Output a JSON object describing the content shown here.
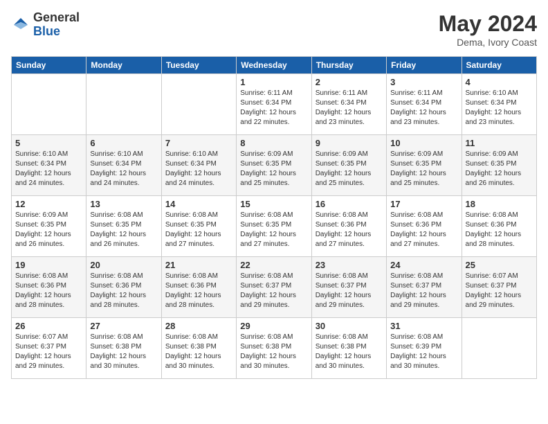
{
  "logo": {
    "general": "General",
    "blue": "Blue"
  },
  "calendar": {
    "title": "May 2024",
    "subtitle": "Dema, Ivory Coast"
  },
  "weekdays": [
    "Sunday",
    "Monday",
    "Tuesday",
    "Wednesday",
    "Thursday",
    "Friday",
    "Saturday"
  ],
  "weeks": [
    [
      {
        "day": "",
        "sunrise": "",
        "sunset": "",
        "daylight": ""
      },
      {
        "day": "",
        "sunrise": "",
        "sunset": "",
        "daylight": ""
      },
      {
        "day": "",
        "sunrise": "",
        "sunset": "",
        "daylight": ""
      },
      {
        "day": "1",
        "sunrise": "Sunrise: 6:11 AM",
        "sunset": "Sunset: 6:34 PM",
        "daylight": "Daylight: 12 hours and 22 minutes."
      },
      {
        "day": "2",
        "sunrise": "Sunrise: 6:11 AM",
        "sunset": "Sunset: 6:34 PM",
        "daylight": "Daylight: 12 hours and 23 minutes."
      },
      {
        "day": "3",
        "sunrise": "Sunrise: 6:11 AM",
        "sunset": "Sunset: 6:34 PM",
        "daylight": "Daylight: 12 hours and 23 minutes."
      },
      {
        "day": "4",
        "sunrise": "Sunrise: 6:10 AM",
        "sunset": "Sunset: 6:34 PM",
        "daylight": "Daylight: 12 hours and 23 minutes."
      }
    ],
    [
      {
        "day": "5",
        "sunrise": "Sunrise: 6:10 AM",
        "sunset": "Sunset: 6:34 PM",
        "daylight": "Daylight: 12 hours and 24 minutes."
      },
      {
        "day": "6",
        "sunrise": "Sunrise: 6:10 AM",
        "sunset": "Sunset: 6:34 PM",
        "daylight": "Daylight: 12 hours and 24 minutes."
      },
      {
        "day": "7",
        "sunrise": "Sunrise: 6:10 AM",
        "sunset": "Sunset: 6:34 PM",
        "daylight": "Daylight: 12 hours and 24 minutes."
      },
      {
        "day": "8",
        "sunrise": "Sunrise: 6:09 AM",
        "sunset": "Sunset: 6:35 PM",
        "daylight": "Daylight: 12 hours and 25 minutes."
      },
      {
        "day": "9",
        "sunrise": "Sunrise: 6:09 AM",
        "sunset": "Sunset: 6:35 PM",
        "daylight": "Daylight: 12 hours and 25 minutes."
      },
      {
        "day": "10",
        "sunrise": "Sunrise: 6:09 AM",
        "sunset": "Sunset: 6:35 PM",
        "daylight": "Daylight: 12 hours and 25 minutes."
      },
      {
        "day": "11",
        "sunrise": "Sunrise: 6:09 AM",
        "sunset": "Sunset: 6:35 PM",
        "daylight": "Daylight: 12 hours and 26 minutes."
      }
    ],
    [
      {
        "day": "12",
        "sunrise": "Sunrise: 6:09 AM",
        "sunset": "Sunset: 6:35 PM",
        "daylight": "Daylight: 12 hours and 26 minutes."
      },
      {
        "day": "13",
        "sunrise": "Sunrise: 6:08 AM",
        "sunset": "Sunset: 6:35 PM",
        "daylight": "Daylight: 12 hours and 26 minutes."
      },
      {
        "day": "14",
        "sunrise": "Sunrise: 6:08 AM",
        "sunset": "Sunset: 6:35 PM",
        "daylight": "Daylight: 12 hours and 27 minutes."
      },
      {
        "day": "15",
        "sunrise": "Sunrise: 6:08 AM",
        "sunset": "Sunset: 6:35 PM",
        "daylight": "Daylight: 12 hours and 27 minutes."
      },
      {
        "day": "16",
        "sunrise": "Sunrise: 6:08 AM",
        "sunset": "Sunset: 6:36 PM",
        "daylight": "Daylight: 12 hours and 27 minutes."
      },
      {
        "day": "17",
        "sunrise": "Sunrise: 6:08 AM",
        "sunset": "Sunset: 6:36 PM",
        "daylight": "Daylight: 12 hours and 27 minutes."
      },
      {
        "day": "18",
        "sunrise": "Sunrise: 6:08 AM",
        "sunset": "Sunset: 6:36 PM",
        "daylight": "Daylight: 12 hours and 28 minutes."
      }
    ],
    [
      {
        "day": "19",
        "sunrise": "Sunrise: 6:08 AM",
        "sunset": "Sunset: 6:36 PM",
        "daylight": "Daylight: 12 hours and 28 minutes."
      },
      {
        "day": "20",
        "sunrise": "Sunrise: 6:08 AM",
        "sunset": "Sunset: 6:36 PM",
        "daylight": "Daylight: 12 hours and 28 minutes."
      },
      {
        "day": "21",
        "sunrise": "Sunrise: 6:08 AM",
        "sunset": "Sunset: 6:36 PM",
        "daylight": "Daylight: 12 hours and 28 minutes."
      },
      {
        "day": "22",
        "sunrise": "Sunrise: 6:08 AM",
        "sunset": "Sunset: 6:37 PM",
        "daylight": "Daylight: 12 hours and 29 minutes."
      },
      {
        "day": "23",
        "sunrise": "Sunrise: 6:08 AM",
        "sunset": "Sunset: 6:37 PM",
        "daylight": "Daylight: 12 hours and 29 minutes."
      },
      {
        "day": "24",
        "sunrise": "Sunrise: 6:08 AM",
        "sunset": "Sunset: 6:37 PM",
        "daylight": "Daylight: 12 hours and 29 minutes."
      },
      {
        "day": "25",
        "sunrise": "Sunrise: 6:07 AM",
        "sunset": "Sunset: 6:37 PM",
        "daylight": "Daylight: 12 hours and 29 minutes."
      }
    ],
    [
      {
        "day": "26",
        "sunrise": "Sunrise: 6:07 AM",
        "sunset": "Sunset: 6:37 PM",
        "daylight": "Daylight: 12 hours and 29 minutes."
      },
      {
        "day": "27",
        "sunrise": "Sunrise: 6:08 AM",
        "sunset": "Sunset: 6:38 PM",
        "daylight": "Daylight: 12 hours and 30 minutes."
      },
      {
        "day": "28",
        "sunrise": "Sunrise: 6:08 AM",
        "sunset": "Sunset: 6:38 PM",
        "daylight": "Daylight: 12 hours and 30 minutes."
      },
      {
        "day": "29",
        "sunrise": "Sunrise: 6:08 AM",
        "sunset": "Sunset: 6:38 PM",
        "daylight": "Daylight: 12 hours and 30 minutes."
      },
      {
        "day": "30",
        "sunrise": "Sunrise: 6:08 AM",
        "sunset": "Sunset: 6:38 PM",
        "daylight": "Daylight: 12 hours and 30 minutes."
      },
      {
        "day": "31",
        "sunrise": "Sunrise: 6:08 AM",
        "sunset": "Sunset: 6:39 PM",
        "daylight": "Daylight: 12 hours and 30 minutes."
      },
      {
        "day": "",
        "sunrise": "",
        "sunset": "",
        "daylight": ""
      }
    ]
  ]
}
